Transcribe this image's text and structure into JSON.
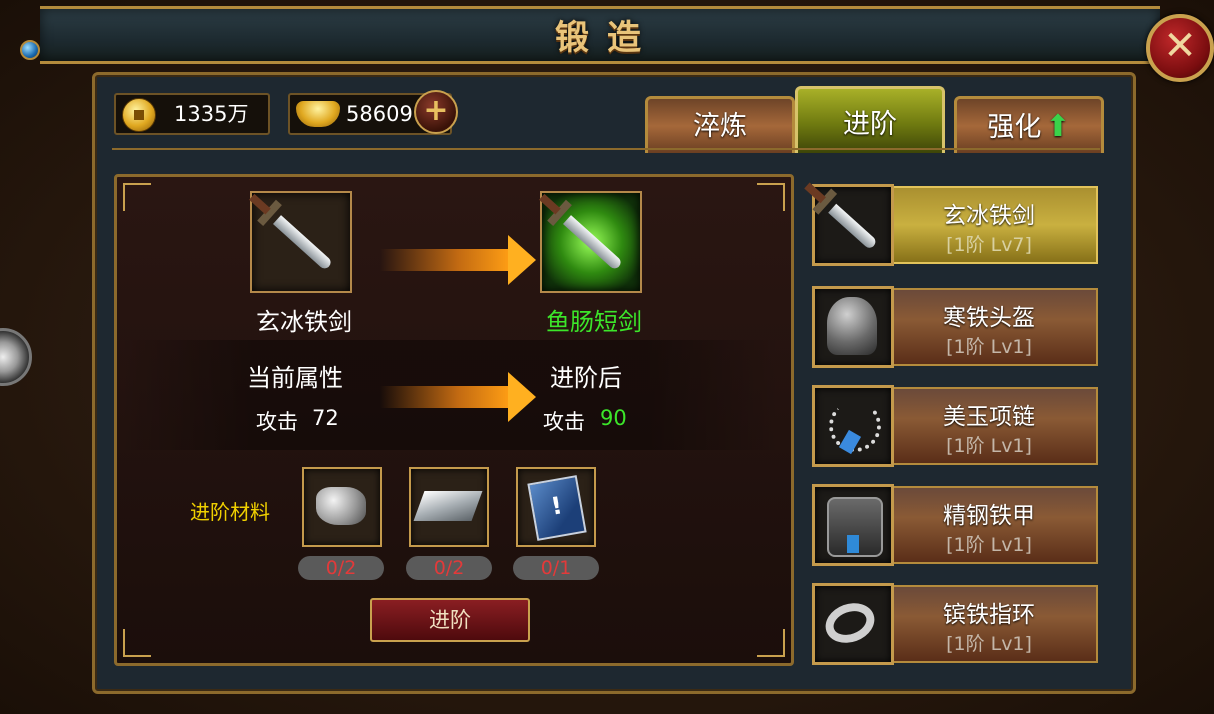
{
  "title": "锻造",
  "currency": {
    "coins": "1335万",
    "ingots": "58609"
  },
  "tabs": [
    {
      "label": "淬炼",
      "active": false
    },
    {
      "label": "进阶",
      "active": true
    },
    {
      "label": "强化",
      "active": false
    }
  ],
  "forge": {
    "current_item": "玄冰铁剑",
    "next_item": "鱼肠短剑",
    "current_attr_title": "当前属性",
    "next_attr_title": "进阶后",
    "current_attr_label": "攻击",
    "current_attr_value": "72",
    "next_attr_label": "攻击",
    "next_attr_value": "90",
    "materials_label": "进阶材料",
    "materials": [
      {
        "icon": "ore-icon",
        "count": "0/2"
      },
      {
        "icon": "iron-bar-icon",
        "count": "0/2"
      },
      {
        "icon": "book-icon",
        "count": "0/1"
      }
    ],
    "advance_button": "进阶"
  },
  "equipment": [
    {
      "name": "玄冰铁剑",
      "level": "[1阶 Lv7]",
      "icon": "sword-icon",
      "selected": true
    },
    {
      "name": "寒铁头盔",
      "level": "[1阶 Lv1]",
      "icon": "helmet-icon",
      "selected": false
    },
    {
      "name": "美玉项链",
      "level": "[1阶 Lv1]",
      "icon": "necklace-icon",
      "selected": false
    },
    {
      "name": "精钢铁甲",
      "level": "[1阶 Lv1]",
      "icon": "armor-icon",
      "selected": false
    },
    {
      "name": "镔铁指环",
      "level": "[1阶 Lv1]",
      "icon": "ring-icon",
      "selected": false
    }
  ],
  "colors": {
    "gold_border": "#b48b3c",
    "green_text": "#3ce62a",
    "yellow_label": "#f0d000",
    "red_count": "#e23a3a"
  }
}
